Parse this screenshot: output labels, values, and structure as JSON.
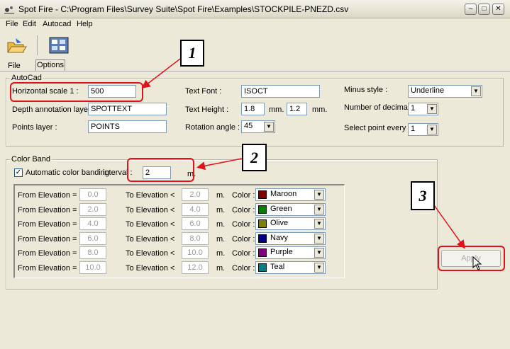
{
  "window": {
    "title": "Spot Fire - C:\\Program Files\\Survey Suite\\Spot Fire\\Examples\\STOCKPILE-PNEZD.csv"
  },
  "menu": [
    "File",
    "Edit",
    "Autocad",
    "Help"
  ],
  "tabs": [
    "File",
    "Options"
  ],
  "autocad": {
    "group_label": "AutoCad",
    "horizontal_scale": {
      "label": "Horizontal scale 1 :",
      "value": "500"
    },
    "depth_layer": {
      "label": "Depth annotation layer :",
      "value": "SPOTTEXT"
    },
    "points_layer": {
      "label": "Points layer :",
      "value": "POINTS"
    },
    "text_font": {
      "label": "Text Font :",
      "value": "ISOCT"
    },
    "text_height": {
      "label": "Text Height :",
      "value1": "1.8",
      "unit1": "mm.",
      "value2": "1.2",
      "unit2": "mm."
    },
    "rotation": {
      "label": "Rotation angle :",
      "value": "45"
    },
    "minus_style": {
      "label": "Minus style :",
      "value": "Underline"
    },
    "decimals": {
      "label": "Number of decimal :",
      "value": "1"
    },
    "select_every": {
      "label": "Select point every :",
      "value": "1"
    }
  },
  "color_band": {
    "group_label": "Color Band",
    "auto_label": "Automatic color banding",
    "auto_checked": true,
    "interval_label": "interval :",
    "interval_value": "2",
    "interval_unit": "m.",
    "from_label": "From Elevation =",
    "to_label": "To Elevation <",
    "unit": "m.",
    "color_label": "Color :",
    "rows": [
      {
        "from": "0.0",
        "to": "2.0",
        "color": "Maroon",
        "hex": "#800000"
      },
      {
        "from": "2.0",
        "to": "4.0",
        "color": "Green",
        "hex": "#008000"
      },
      {
        "from": "4.0",
        "to": "6.0",
        "color": "Olive",
        "hex": "#808000"
      },
      {
        "from": "6.0",
        "to": "8.0",
        "color": "Navy",
        "hex": "#000080"
      },
      {
        "from": "8.0",
        "to": "10.0",
        "color": "Purple",
        "hex": "#800080"
      },
      {
        "from": "10.0",
        "to": "12.0",
        "color": "Teal",
        "hex": "#008080"
      }
    ]
  },
  "apply_label": "Apply",
  "callouts": [
    "1",
    "2",
    "3"
  ],
  "colors": {
    "highlight": "#e0111b"
  }
}
